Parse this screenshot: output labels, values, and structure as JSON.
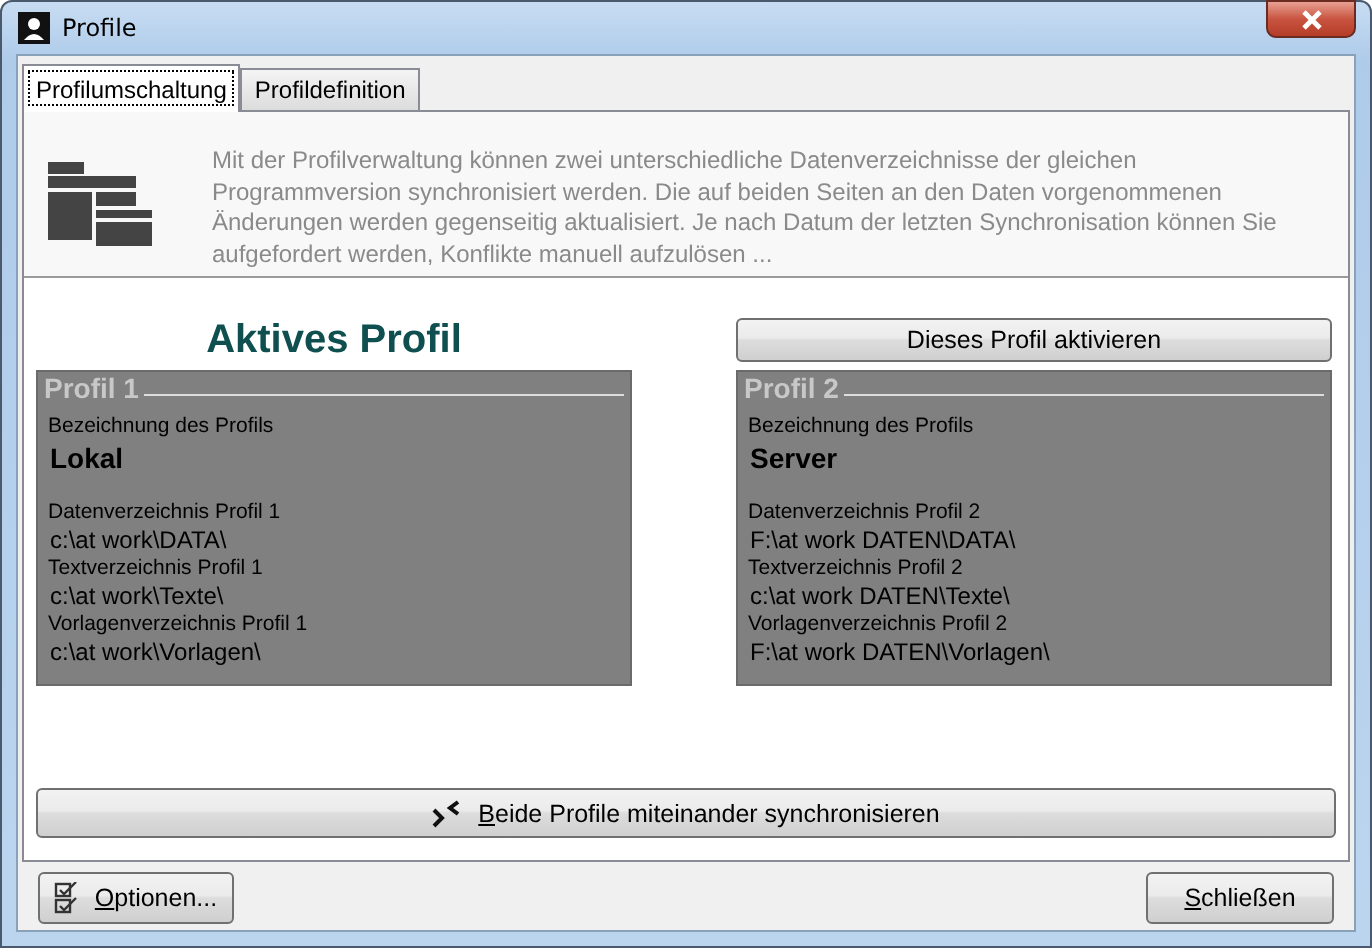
{
  "window": {
    "title": "Profile"
  },
  "tabs": [
    {
      "label": "Profilumschaltung",
      "selected": true
    },
    {
      "label": "Profildefinition",
      "selected": false
    }
  ],
  "description": "Mit der Profilverwaltung können zwei unterschiedliche Datenverzeichnisse der gleichen Programmversion synchronisiert werden. Die auf beiden Seiten an den Daten vorgenommenen Änderungen werden gegenseitig aktualisiert. Je nach Datum der letzten Synchronisation können Sie aufgefordert werden, Konflikte manuell aufzulösen ...",
  "profiles": [
    {
      "header": {
        "kind": "heading",
        "text": "Aktives Profil"
      },
      "title": "Profil 1",
      "name_label": "Bezeichnung des Profils",
      "name": "Lokal",
      "paths": [
        {
          "label": "Datenverzeichnis Profil 1",
          "value": "c:\\at work\\DATA\\"
        },
        {
          "label": "Textverzeichnis Profil 1",
          "value": "c:\\at work\\Texte\\"
        },
        {
          "label": "Vorlagenverzeichnis Profil 1",
          "value": "c:\\at work\\Vorlagen\\"
        }
      ]
    },
    {
      "header": {
        "kind": "button",
        "text": "Dieses Profil aktivieren"
      },
      "title": "Profil 2",
      "name_label": "Bezeichnung des Profils",
      "name": "Server",
      "paths": [
        {
          "label": "Datenverzeichnis Profil 2",
          "value": "F:\\at work DATEN\\DATA\\"
        },
        {
          "label": "Textverzeichnis Profil 2",
          "value": "c:\\at work DATEN\\Texte\\"
        },
        {
          "label": "Vorlagenverzeichnis Profil 2",
          "value": "F:\\at work DATEN\\Vorlagen\\"
        }
      ]
    }
  ],
  "sync_button": {
    "label": "Beide Profile miteinander synchronisieren",
    "mnemonic_first": true
  },
  "footer_buttons": [
    {
      "kind": "options",
      "label": "Optionen...",
      "mnemonic_first": true
    },
    {
      "kind": "close",
      "label": "Schließen",
      "mnemonic_first": true
    }
  ]
}
